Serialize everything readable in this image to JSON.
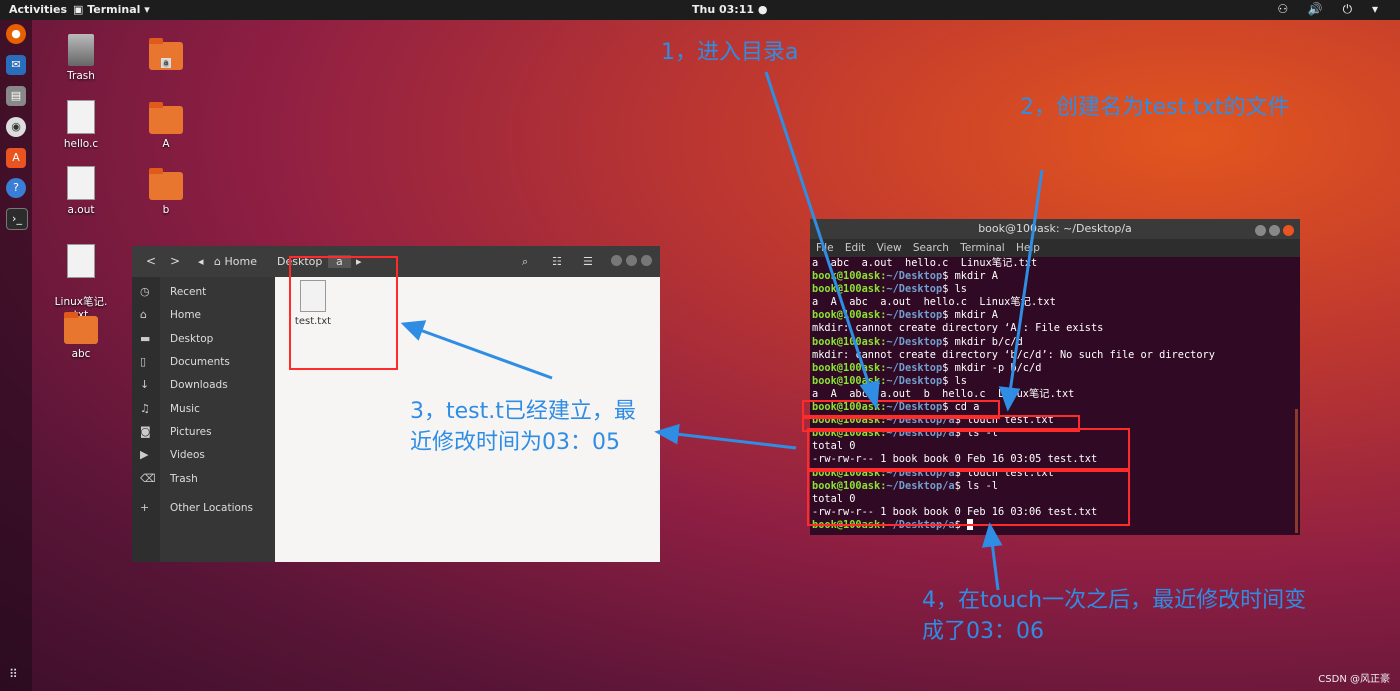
{
  "topbar": {
    "activities": "Activities",
    "app": "Terminal",
    "app_arrow": "▾",
    "clock": "Thu 03:11 ●",
    "tray": "⚇ 🔊 ⏻ ▾"
  },
  "desktop_icons": [
    {
      "label": "Trash"
    },
    {
      "label": "hello.c"
    },
    {
      "label": "a.out"
    },
    {
      "label": "Linux笔记.\ntxt"
    },
    {
      "label": "abc"
    },
    {
      "label": "a"
    },
    {
      "label": "A"
    },
    {
      "label": "b"
    }
  ],
  "files": {
    "nav_back": "<",
    "nav_fwd": ">",
    "crumbs": [
      "Home",
      "Desktop",
      "a"
    ],
    "sidebar": [
      "Recent",
      "Home",
      "Desktop",
      "Documents",
      "Downloads",
      "Music",
      "Pictures",
      "Videos",
      "Trash",
      "Other Locations"
    ],
    "file_name": "test.txt"
  },
  "terminal": {
    "title": "book@100ask: ~/Desktop/a",
    "menu": [
      "File",
      "Edit",
      "View",
      "Search",
      "Terminal",
      "Help"
    ],
    "prompt_user": "book@100ask:",
    "lines": [
      {
        "o": "a  abc  a.out  hello.c  Linux笔记.txt"
      },
      {
        "pd": "~/Desktop",
        "c": "$ mkdir A"
      },
      {
        "pd": "~/Desktop",
        "c": "$ ls"
      },
      {
        "o": "a  A  abc  a.out  hello.c  Linux笔记.txt"
      },
      {
        "pd": "~/Desktop",
        "c": "$ mkdir A"
      },
      {
        "o": "mkdir: cannot create directory ‘A’: File exists"
      },
      {
        "pd": "~/Desktop",
        "c": "$ mkdir b/c/d"
      },
      {
        "o": "mkdir: cannot create directory ‘b/c/d’: No such file or directory"
      },
      {
        "pd": "~/Desktop",
        "c": "$ mkdir -p b/c/d"
      },
      {
        "pd": "~/Desktop",
        "c": "$ ls"
      },
      {
        "o": "a  A  abc  a.out  b  hello.c  Linux笔记.txt"
      },
      {
        "pd": "~/Desktop",
        "c": "$ cd a"
      },
      {
        "pd": "~/Desktop/a",
        "c": "$ touch test.txt"
      },
      {
        "pd": "~/Desktop/a",
        "c": "$ ls -l"
      },
      {
        "o": "total 0"
      },
      {
        "o": "-rw-rw-r-- 1 book book 0 Feb 16 03:05 test.txt"
      },
      {
        "pd": "~/Desktop/a",
        "c": "$ touch test.txt"
      },
      {
        "pd": "~/Desktop/a",
        "c": "$ ls -l"
      },
      {
        "o": "total 0"
      },
      {
        "o": "-rw-rw-r-- 1 book book 0 Feb 16 03:06 test.txt"
      },
      {
        "pd": "~/Desktop/a",
        "c": "$ ",
        "cursor": true
      }
    ]
  },
  "annotations": {
    "a1": "1，进入目录a",
    "a2": "2，创建名为test.txt的文件",
    "a3_l1": "3，test.t已经建立，最",
    "a3_l2": "近修改时间为03：05",
    "a4_l1": "4，在touch一次之后，最近修改时间变",
    "a4_l2": "成了03：06",
    "color": "#2f8de4"
  },
  "watermark": "CSDN @风正豪"
}
